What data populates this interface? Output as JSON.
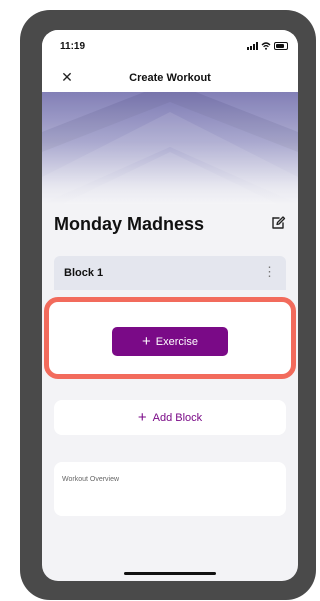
{
  "status_bar": {
    "time": "11:19"
  },
  "nav": {
    "close_icon": "close-icon",
    "title": "Create Workout"
  },
  "workout": {
    "title": "Monday Madness",
    "edit_icon": "edit-pencil-icon"
  },
  "block": {
    "label": "Block 1",
    "menu_icon": "more-vertical-icon"
  },
  "exercise_button": {
    "plus": "+",
    "label": "Exercise"
  },
  "add_block_button": {
    "plus": "+",
    "label": "Add Block"
  },
  "overview": {
    "placeholder": "Workout Overview"
  },
  "colors": {
    "accent": "#7a0a87",
    "highlight_border": "#f26b5c",
    "hero_top": "#7c79b3",
    "background": "#f3f3f6"
  }
}
